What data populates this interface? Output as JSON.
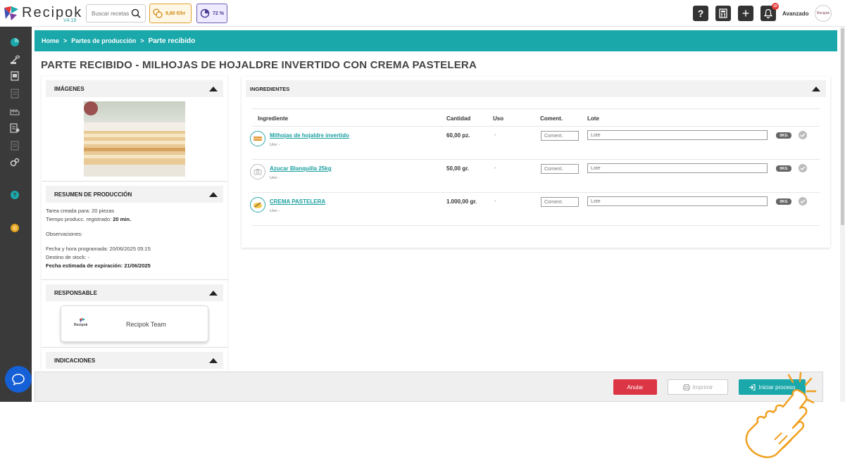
{
  "header": {
    "app_name": "Recipok",
    "version": "V4.19",
    "search_placeholder": "Buscar recetas...",
    "cost_per_hour": "9,80 €/hr",
    "percent": "72 %",
    "help_label": "?",
    "plus_label": "+",
    "notifications_count": "15",
    "user_level": "Avanzado",
    "avatar_text": "Recipok"
  },
  "breadcrumb": {
    "home": "Home",
    "sep": ">",
    "section": "Partes de producción",
    "current": "Parte recibido"
  },
  "page_title": "PARTE RECIBIDO - MILHOJAS DE HOJALDRE INVERTIDO CON CREMA PASTELERA",
  "panels": {
    "images_title": "IMÁGENES",
    "summary_title": "RESUMEN DE PRODUCCIÓN",
    "responsable_title": "RESPONSABLE",
    "indicaciones_title": "INDICACIONES"
  },
  "summary": {
    "task_label": "Tarea creada para:",
    "task_value": "20 piezas",
    "time_label": "Tiempo producc. registrado:",
    "time_value": "20 min.",
    "obs_label": "Observaciones:",
    "date_label": "Fecha y hora programada:",
    "date_value": "20/06/2025 05:15",
    "stock_label": "Destino de stock:",
    "stock_value": "-",
    "expiry_label": "Fecha estimada de expiración:",
    "expiry_value": "21/06/2025"
  },
  "responsable": {
    "logo_text": "Recipok",
    "name": "Recipok Team"
  },
  "ingredients": {
    "title": "INGREDIENTES",
    "columns": {
      "ingrediente": "Ingrediente",
      "cantidad": "Cantidad",
      "uso": "Uso",
      "coment": "Coment.",
      "lote": "Lote"
    },
    "rows": [
      {
        "name": "Milhojas de hojaldre invertido",
        "uso_sub": "Uso: -",
        "qty": "60,00 pz.",
        "uso": "-",
        "coment_placeholder": "Coment.",
        "lote_placeholder": "Lote",
        "badge": "0KG"
      },
      {
        "name": "Azucar Blanquilla 25kg",
        "uso_sub": "Uso: -",
        "qty": "50,00 gr.",
        "uso": "-",
        "coment_placeholder": "Coment.",
        "lote_placeholder": "Lote",
        "badge": "0KG"
      },
      {
        "name": "CREMA PASTELERA",
        "uso_sub": "Uso: -",
        "qty": "1.000,00 gr.",
        "uso": "-",
        "coment_placeholder": "Coment.",
        "lote_placeholder": "Lote",
        "badge": "0KG"
      }
    ]
  },
  "actions": {
    "anular": "Anular",
    "imprimir": "Imprimir",
    "iniciar": "Iniciar proceso"
  },
  "colors": {
    "accent": "#1aa8ab",
    "danger": "#dc3545",
    "sidebar": "#3a3a3a"
  }
}
